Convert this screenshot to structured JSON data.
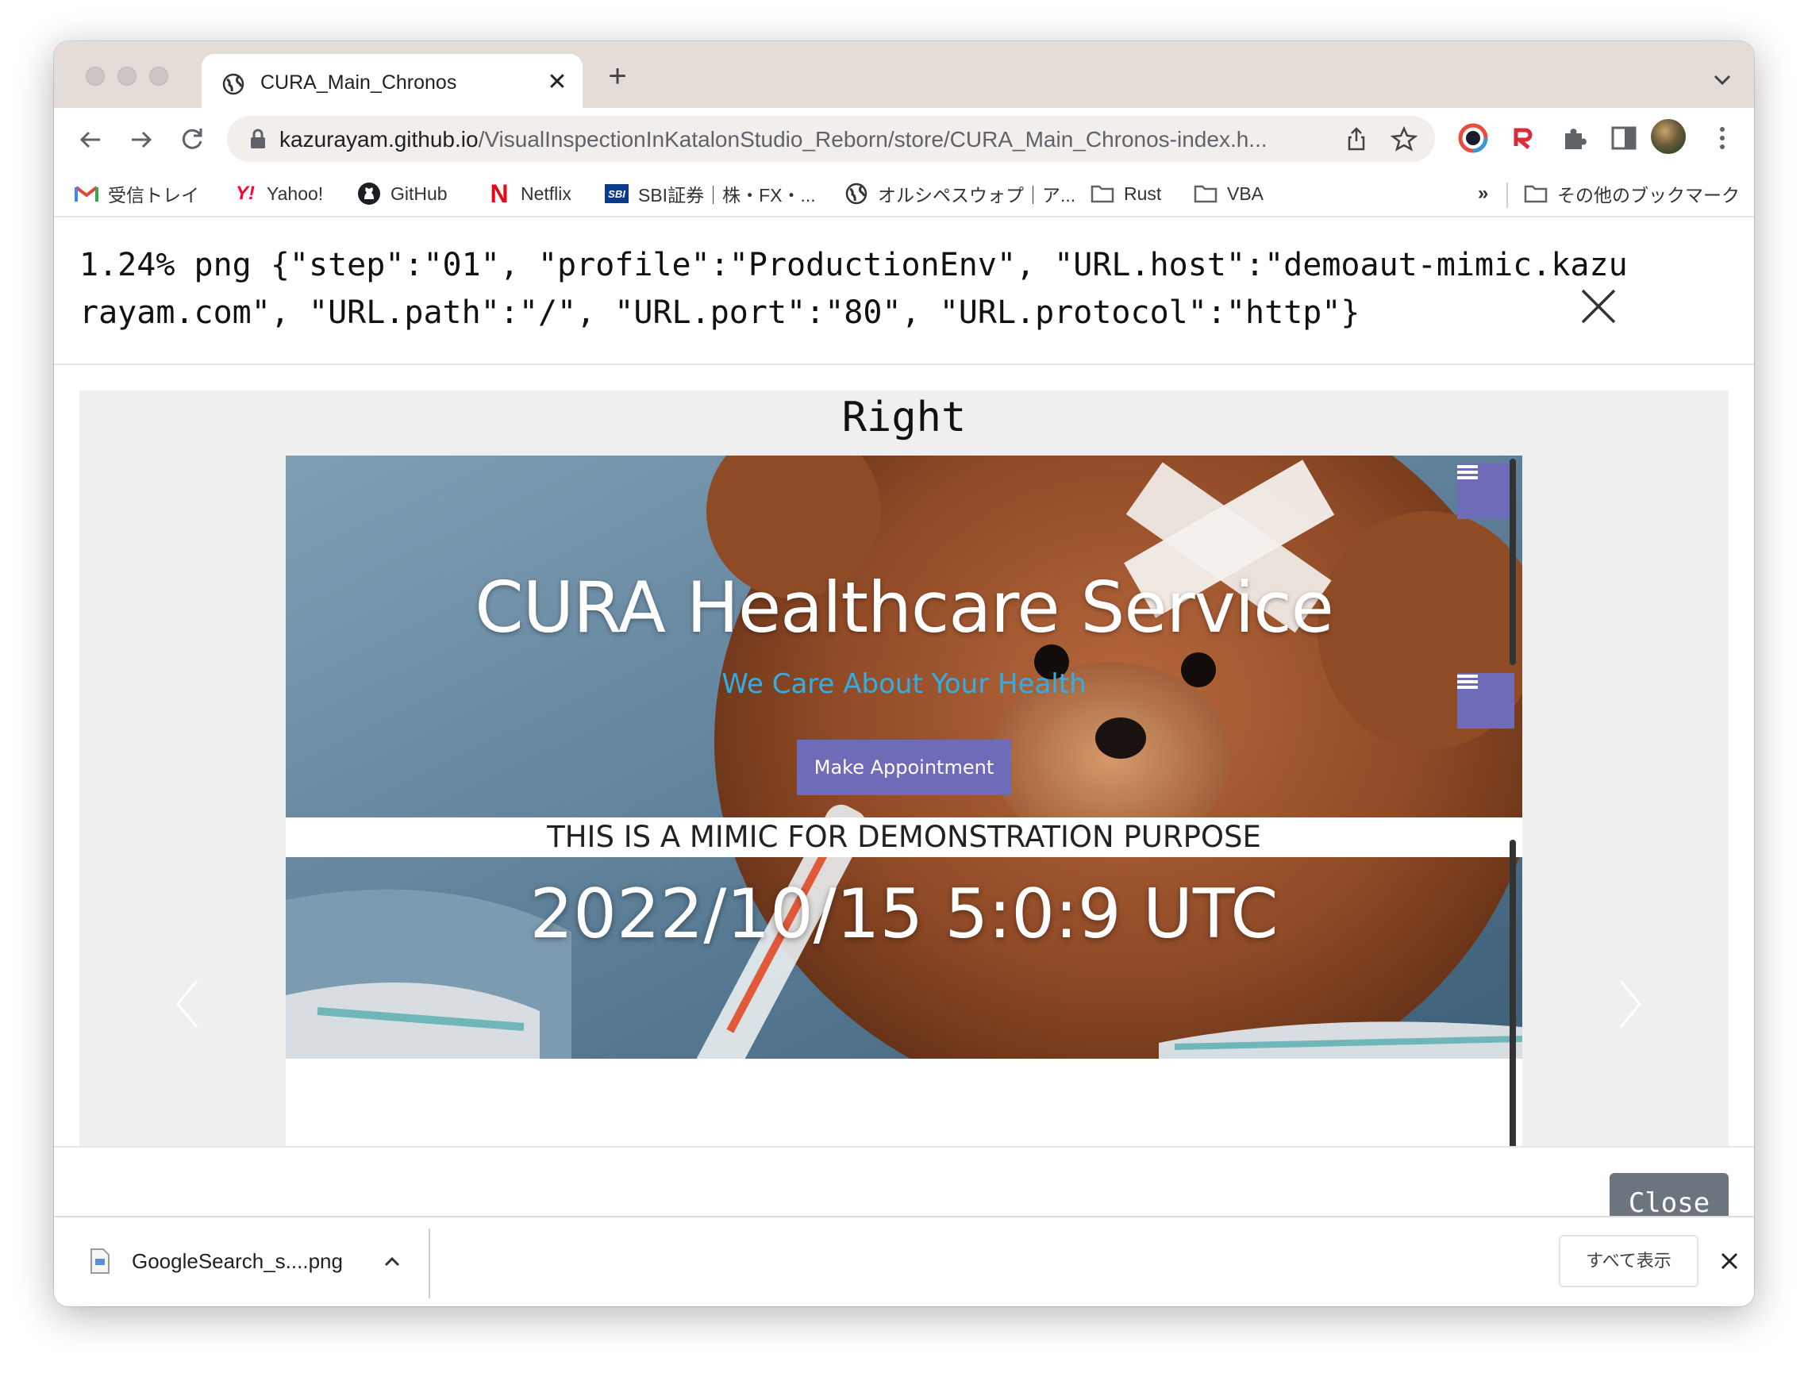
{
  "tab": {
    "title": "CURA_Main_Chronos",
    "close": "✕",
    "new_tab": "+"
  },
  "omnibox": {
    "host": "kazurayam.github.io",
    "path": "/VisualInspectionInKatalonStudio_Reborn/store/CURA_Main_Chronos-index.h..."
  },
  "bookmarks": [
    {
      "label": "受信トレイ",
      "icon": "gmail-icon"
    },
    {
      "label": "Yahoo!",
      "icon": "yahoo-icon"
    },
    {
      "label": "GitHub",
      "icon": "github-icon"
    },
    {
      "label": "Netflix",
      "icon": "netflix-icon"
    },
    {
      "label": "SBI証券｜株・FX・...",
      "icon": "sbi-icon"
    },
    {
      "label": "オルシペスウォプ｜ア...",
      "icon": "globe-icon"
    },
    {
      "label": "Rust",
      "icon": "folder-icon"
    },
    {
      "label": "VBA",
      "icon": "folder-icon"
    }
  ],
  "bookmarks_overflow": "»",
  "other_bookmarks": "その他のブックマーク",
  "modal": {
    "title": "1.24% png {\"step\":\"01\", \"profile\":\"ProductionEnv\", \"URL.host\":\"demoaut-mimic.kazurayam.com\", \"URL.path\":\"/\", \"URL.port\":\"80\", \"URL.protocol\":\"http\"}",
    "panel_label": "Right",
    "close_button": "Close"
  },
  "screenshot": {
    "title": "CURA Healthcare Service",
    "subtitle": "We Care About Your Health",
    "appointment_button": "Make Appointment",
    "mimic_banner": "THIS IS A MIMIC FOR DEMONSTRATION PURPOSE",
    "timestamp": "2022/10/15 5:0:9 UTC"
  },
  "downloads": {
    "file_name": "GoogleSearch_s....png",
    "show_all": "すべて表示"
  },
  "colors": {
    "accent_button": "#6e6bb8",
    "subtitle_blue": "#33aee3",
    "close_button": "#6c757d",
    "tabstrip": "#e4dcd7"
  }
}
